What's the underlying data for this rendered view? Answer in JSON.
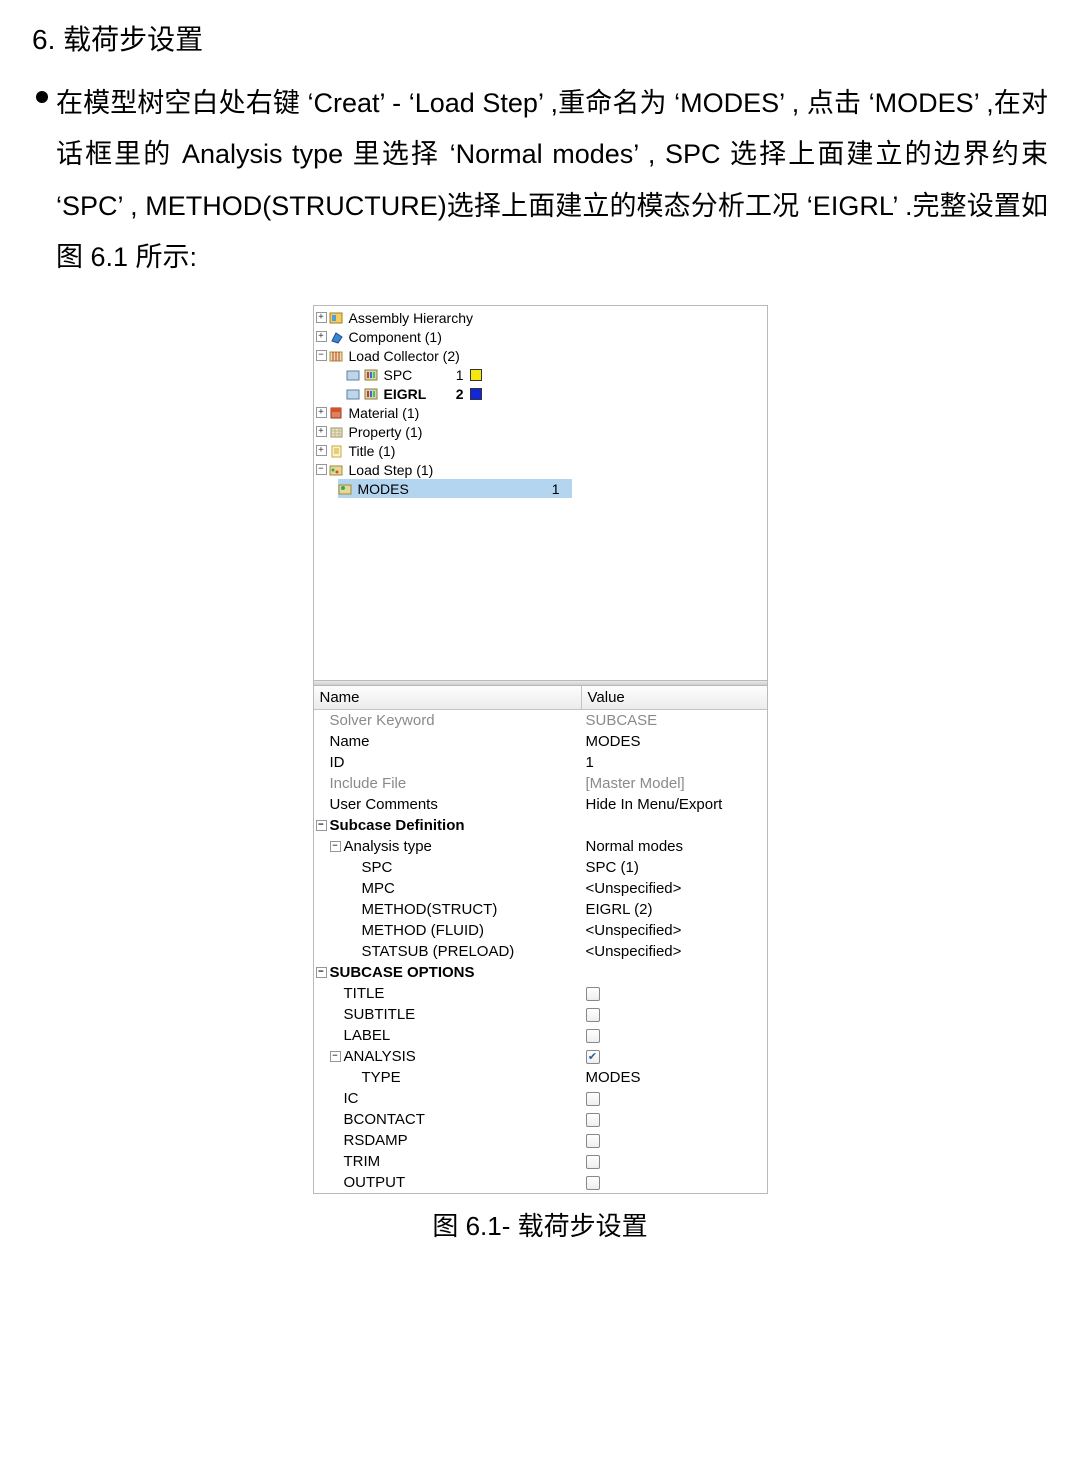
{
  "heading": "6. 载荷步设置",
  "paragraph": "在模型树空白处右键 ‘Creat’ - ‘Load Step’ ,重命名为 ‘MODES’ , 点击 ‘MODES’ ,在对话框里的 Analysis type 里选择 ‘Normal modes’ , SPC 选择上面建立的边界约束 ‘SPC’ , METHOD(STRUCTURE)选择上面建立的模态分析工况 ‘EIGRL’ .完整设置如图 6.1 所示:",
  "tree": {
    "assembly": "Assembly Hierarchy",
    "component": "Component (1)",
    "load_collector": "Load Collector (2)",
    "spc_label": "SPC",
    "spc_id": "1",
    "eigrl_label": "EIGRL",
    "eigrl_id": "2",
    "material": "Material (1)",
    "property": "Property (1)",
    "title": "Title (1)",
    "load_step": "Load Step (1)",
    "modes_label": "MODES",
    "modes_id": "1",
    "spc_color": "#f7e60f",
    "eigrl_color": "#1028d8"
  },
  "props": {
    "header_name": "Name",
    "header_value": "Value",
    "rows": {
      "solver_keyword_n": "Solver Keyword",
      "solver_keyword_v": "SUBCASE",
      "name_n": "Name",
      "name_v": "MODES",
      "id_n": "ID",
      "id_v": "1",
      "include_n": "Include File",
      "include_v": "[Master Model]",
      "usercomments_n": "User Comments",
      "usercomments_v": "Hide In Menu/Export",
      "subcase_def": "Subcase Definition",
      "analysis_type_n": "Analysis type",
      "analysis_type_v": "Normal modes",
      "spc_n": "SPC",
      "spc_v": "SPC (1)",
      "mpc_n": "MPC",
      "mpc_v": "<Unspecified>",
      "method_struct_n": "METHOD(STRUCT)",
      "method_struct_v": "EIGRL (2)",
      "method_fluid_n": "METHOD (FLUID)",
      "method_fluid_v": "<Unspecified>",
      "statsub_n": "STATSUB (PRELOAD)",
      "statsub_v": "<Unspecified>",
      "subcase_opt": "SUBCASE OPTIONS",
      "title_n": "TITLE",
      "subtitle_n": "SUBTITLE",
      "label_n": "LABEL",
      "analysis_n": "ANALYSIS",
      "type_n": "TYPE",
      "type_v": "MODES",
      "ic_n": "IC",
      "bcontact_n": "BCONTACT",
      "rsdamp_n": "RSDAMP",
      "trim_n": "TRIM",
      "output_n": "OUTPUT"
    }
  },
  "caption": "图 6.1- 载荷步设置"
}
